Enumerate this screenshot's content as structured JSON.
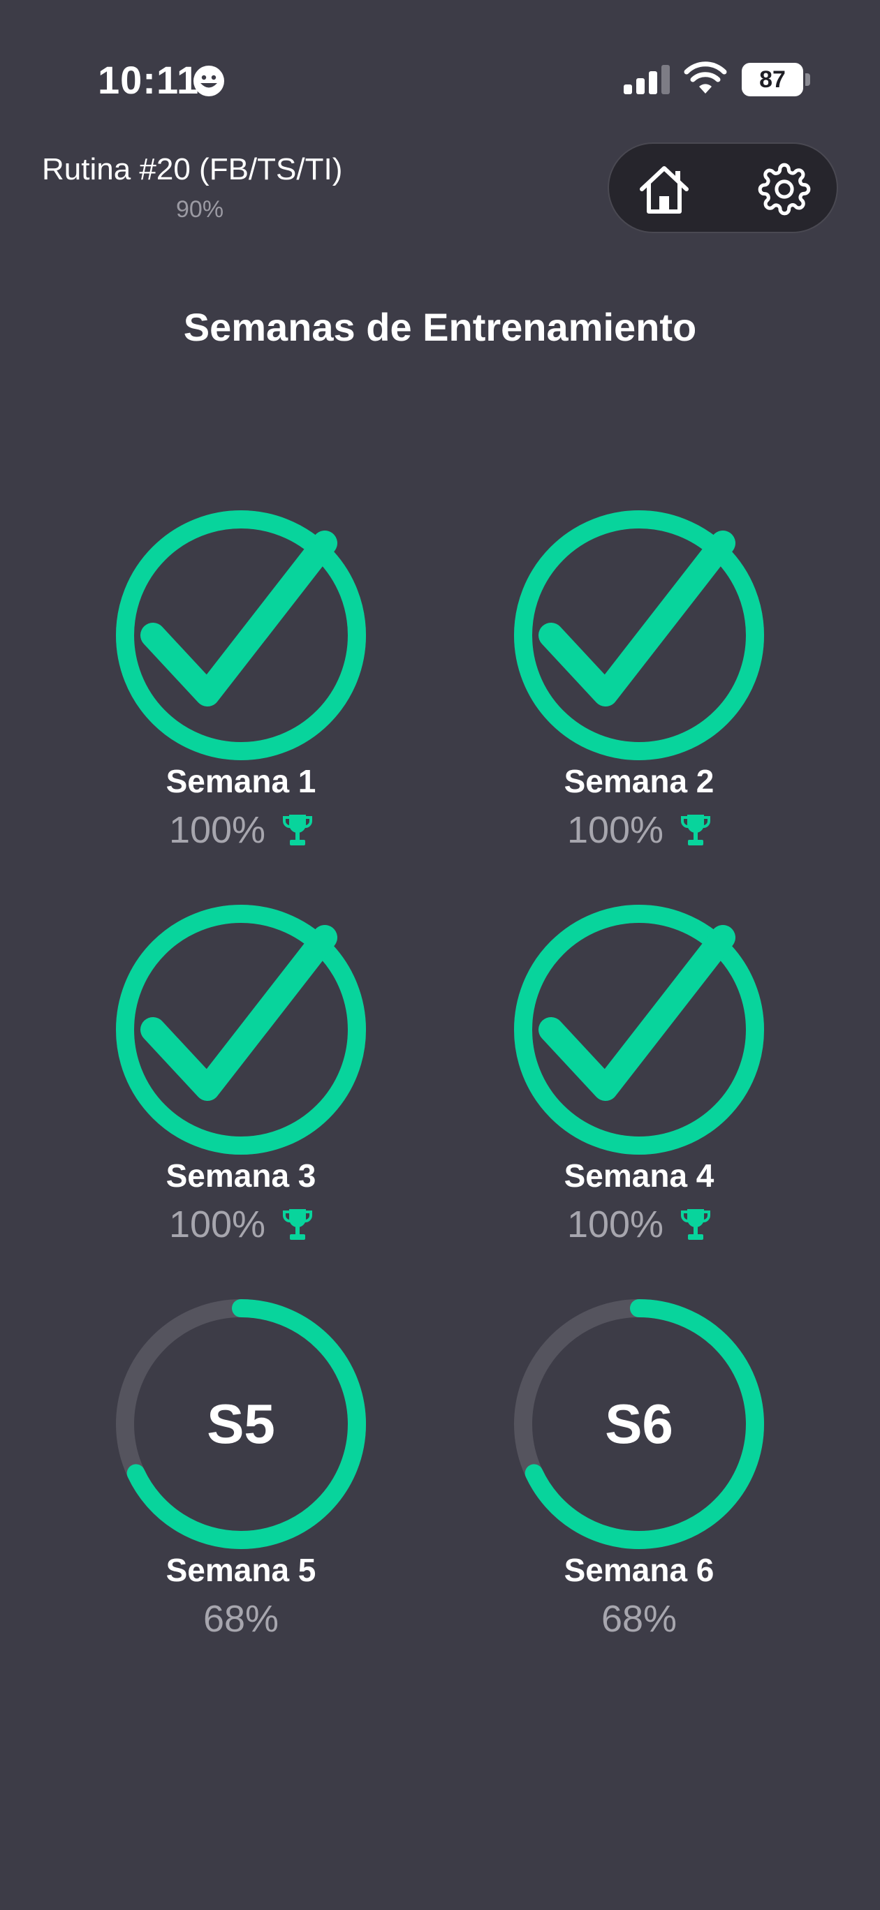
{
  "status_bar": {
    "time": "10:11",
    "battery_level": "87",
    "icons": [
      "emoji-face-icon",
      "cellular-signal-icon",
      "wifi-icon",
      "battery-icon"
    ]
  },
  "header": {
    "routine_title": "Rutina #20 (FB/TS/TI)",
    "routine_progress": "90%",
    "nav_icons": [
      "home-icon",
      "gear-icon"
    ]
  },
  "page_title": "Semanas de Entrenamiento",
  "colors": {
    "background": "#3d3c47",
    "accent": "#08d49c",
    "ring_track": "#55545e",
    "muted_text": "#a7a6ae",
    "pill_background": "#26252c"
  },
  "weeks": [
    {
      "label": "Semana 1",
      "percent": "100%",
      "progress": 1.0,
      "completed": true,
      "code": ""
    },
    {
      "label": "Semana 2",
      "percent": "100%",
      "progress": 1.0,
      "completed": true,
      "code": ""
    },
    {
      "label": "Semana 3",
      "percent": "100%",
      "progress": 1.0,
      "completed": true,
      "code": ""
    },
    {
      "label": "Semana 4",
      "percent": "100%",
      "progress": 1.0,
      "completed": true,
      "code": ""
    },
    {
      "label": "Semana 5",
      "percent": "68%",
      "progress": 0.68,
      "completed": false,
      "code": "S5"
    },
    {
      "label": "Semana 6",
      "percent": "68%",
      "progress": 0.68,
      "completed": false,
      "code": "S6"
    }
  ]
}
